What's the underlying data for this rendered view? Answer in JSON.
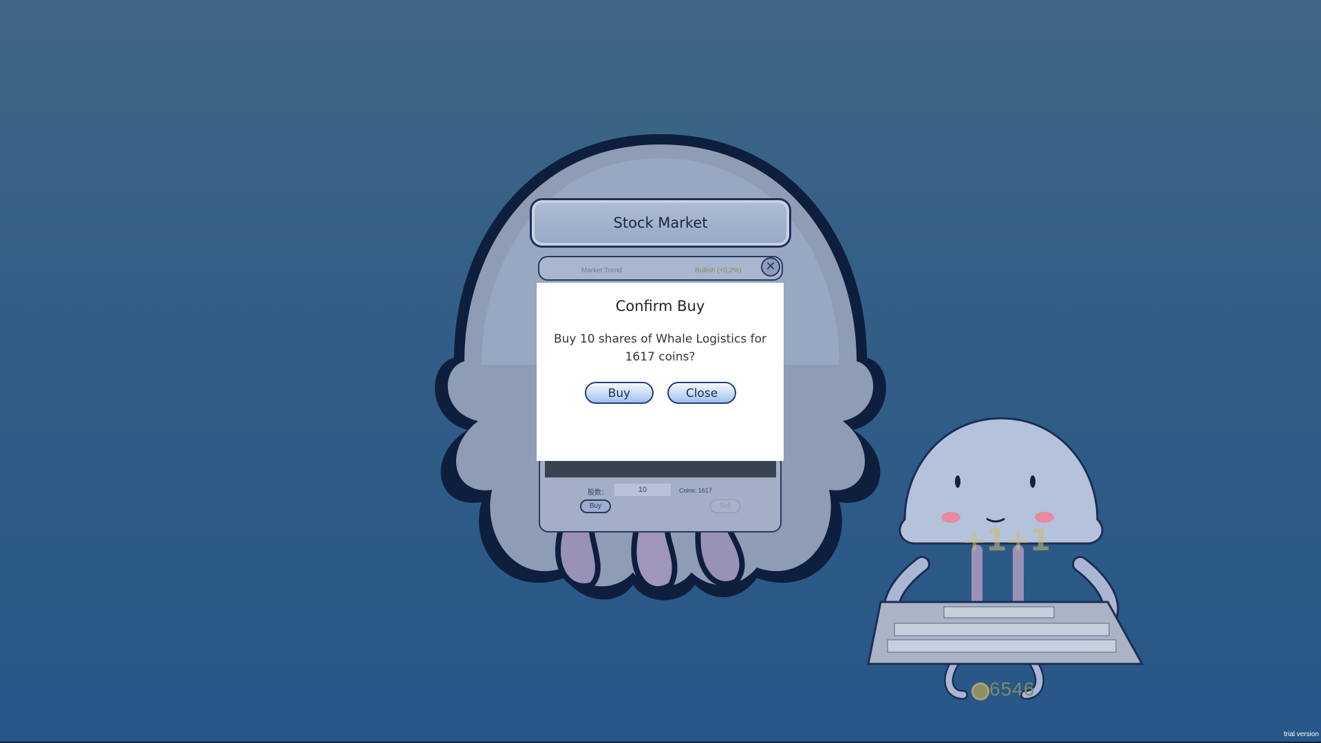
{
  "stock_window": {
    "title": "Stock Market",
    "trend_label": "Market Trend",
    "trend_value": "Bullish (+0.2%)",
    "close_icon": "close-x-icon",
    "shares_label": "股数：",
    "shares_value": "10",
    "coins_label": "Coins: 1617",
    "buy_label": "Buy",
    "sell_label": "Sell"
  },
  "mascot": {
    "coins": "6546",
    "coin_icon": "coin-icon",
    "floating_text": "+1+1"
  },
  "dialog": {
    "title": "Confirm Buy",
    "message": "Buy 10 shares of Whale Logistics for 1617 coins?",
    "confirm_label": "Buy",
    "cancel_label": "Close"
  },
  "watermark": "trial version",
  "colors": {
    "background_top": "#3f6886",
    "background_bottom": "#275787",
    "button_border": "#233a7a",
    "dialog_bg": "#ffffff"
  }
}
